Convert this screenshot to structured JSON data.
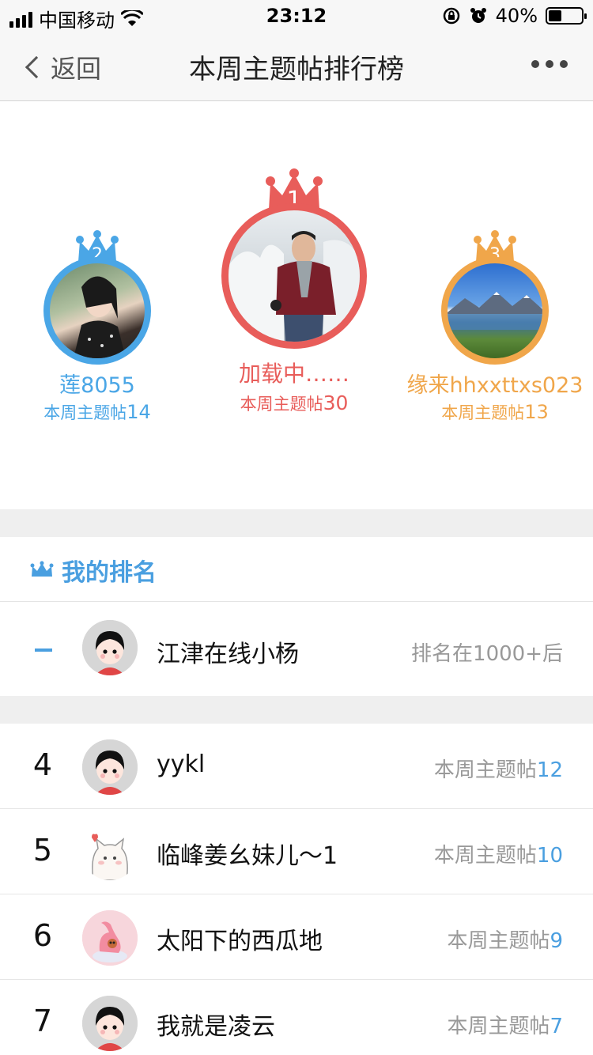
{
  "status_bar": {
    "carrier": "中国移动",
    "time": "23:12",
    "battery": "40%",
    "battery_level": 0.4,
    "icons": [
      "signal-icon",
      "wifi-icon",
      "orientation-lock-icon",
      "alarm-icon",
      "battery-icon"
    ]
  },
  "nav": {
    "back_label": "返回",
    "title": "本周主题帖排行榜",
    "more_icon": "more-icon"
  },
  "podium": {
    "first": {
      "rank": "1",
      "name": "加载中……",
      "stat_label": "本周主题帖",
      "stat_value": "30",
      "color": "#e85d5a"
    },
    "second": {
      "rank": "2",
      "name": "莲8055",
      "stat_label": "本周主题帖",
      "stat_value": "14",
      "color": "#4aa6e6"
    },
    "third": {
      "rank": "3",
      "name": "缘来hhxxttxs023",
      "stat_label": "本周主题帖",
      "stat_value": "13",
      "color": "#f0a64a"
    }
  },
  "my_rank": {
    "title": "我的排名",
    "name": "江津在线小杨",
    "rank_text": "排名在1000+后"
  },
  "list": [
    {
      "rank": "4",
      "name": "yykl",
      "stat_label": "本周主题帖",
      "stat_value": "12"
    },
    {
      "rank": "5",
      "name": "临峰姜幺妹儿～1",
      "stat_label": "本周主题帖",
      "stat_value": "10"
    },
    {
      "rank": "6",
      "name": "太阳下的西瓜地",
      "stat_label": "本周主题帖",
      "stat_value": "9"
    },
    {
      "rank": "7",
      "name": "我就是凌云",
      "stat_label": "本周主题帖",
      "stat_value": "7"
    }
  ],
  "colors": {
    "accent_blue": "#4a9fe0",
    "gold": "#f0a64a",
    "red": "#e85d5a",
    "separator": "#efefef"
  }
}
